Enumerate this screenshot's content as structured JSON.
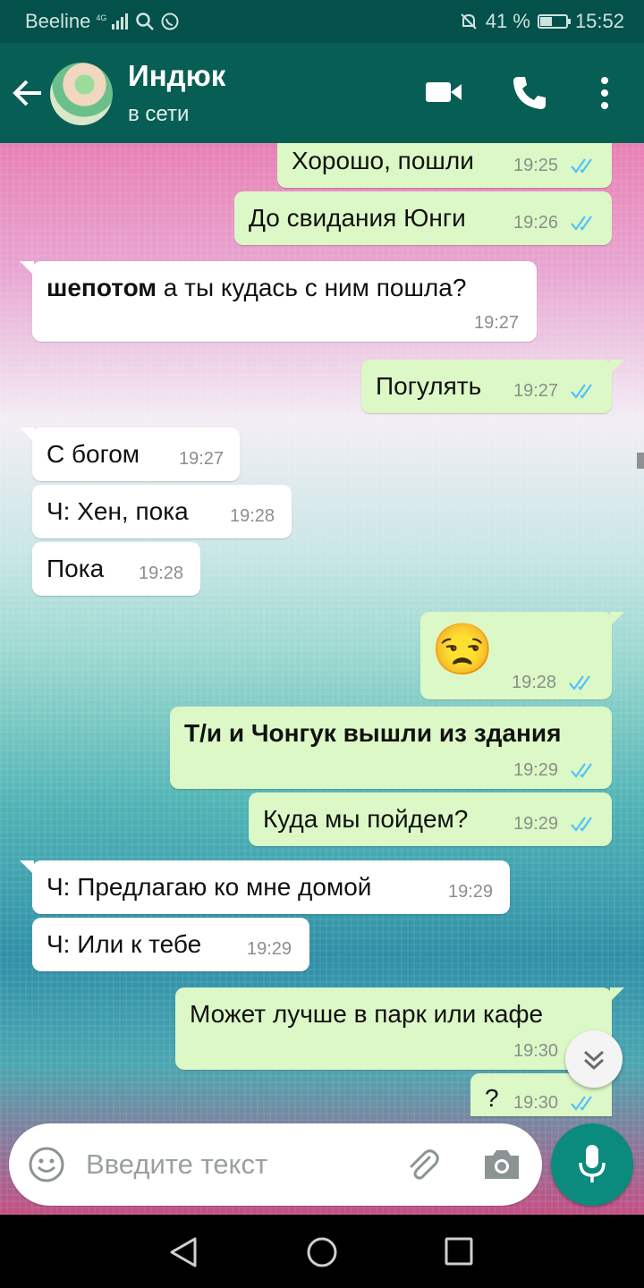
{
  "status_bar": {
    "carrier": "Beeline",
    "network_tag": "4G",
    "battery": "41 %",
    "battery_level": 0.41,
    "time": "15:52"
  },
  "header": {
    "contact_name": "Индюк",
    "contact_status": "в сети"
  },
  "messages": [
    {
      "dir": "out",
      "text": "Хорошо, пошли",
      "time": "19:25"
    },
    {
      "dir": "out",
      "text": "До свидания Юнги",
      "time": "19:26"
    },
    {
      "dir": "in",
      "text_bold": "шепотом",
      "text": " а ты кудась с ним пошла?",
      "time": "19:27"
    },
    {
      "dir": "out",
      "text": "Погулять",
      "time": "19:27"
    },
    {
      "dir": "in",
      "text": "С богом",
      "time": "19:27"
    },
    {
      "dir": "in",
      "text": "Ч: Хен, пока",
      "time": "19:28"
    },
    {
      "dir": "in",
      "text": "Пока",
      "time": "19:28"
    },
    {
      "dir": "out",
      "text": "😒",
      "time": "19:28"
    },
    {
      "dir": "out",
      "text": "Т/и и Чонгук вышли из здания",
      "time": "19:29"
    },
    {
      "dir": "out",
      "text": "Куда мы пойдем?",
      "time": "19:29"
    },
    {
      "dir": "in",
      "text": "Ч: Предлагаю ко мне домой",
      "time": "19:29"
    },
    {
      "dir": "in",
      "text": "Ч: Или к тебе",
      "time": "19:29"
    },
    {
      "dir": "out",
      "text": "Может лучше в парк или кафе",
      "time": "19:30"
    },
    {
      "dir": "out",
      "text": "?",
      "time": "19:30"
    }
  ],
  "input": {
    "placeholder": "Введите текст"
  },
  "colors": {
    "header": "#075e54",
    "status_bar": "#04504a",
    "outgoing_bubble": "#dcf8c6",
    "incoming_bubble": "#ffffff",
    "read_ticks": "#4fc3f7",
    "mic_button": "#0b8a7e"
  },
  "icons": [
    "back-arrow-icon",
    "video-call-icon",
    "phone-icon",
    "more-menu-icon",
    "emoji-icon",
    "attach-icon",
    "camera-icon",
    "mic-icon",
    "scroll-down-icon",
    "nav-back-icon",
    "nav-home-icon",
    "nav-recents-icon"
  ]
}
